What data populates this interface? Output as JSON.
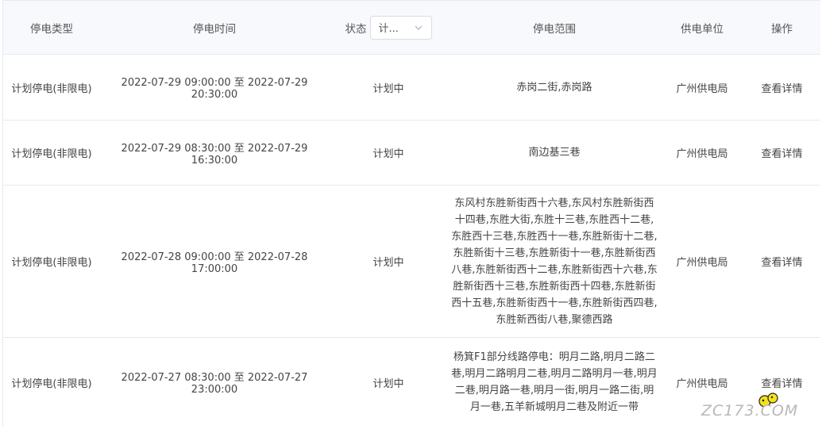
{
  "header": {
    "type": "停电类型",
    "time": "停电时间",
    "status": "状态",
    "status_select": "计...",
    "range": "停电范围",
    "unit": "供电单位",
    "action": "操作"
  },
  "rows": [
    {
      "type": "计划停电(非限电)",
      "time": "2022-07-29 09:00:00 至 2022-07-29 20:30:00",
      "status": "计划中",
      "range": "赤岗二街,赤岗路",
      "unit": "广州供电局",
      "action": "查看详情"
    },
    {
      "type": "计划停电(非限电)",
      "time": "2022-07-29 08:30:00 至 2022-07-29 16:30:00",
      "status": "计划中",
      "range": "南边基三巷",
      "unit": "广州供电局",
      "action": "查看详情"
    },
    {
      "type": "计划停电(非限电)",
      "time": "2022-07-28 09:00:00 至 2022-07-28 17:00:00",
      "status": "计划中",
      "range": "东风村东胜新街西十六巷,东风村东胜新街西十四巷,东胜大街,东胜十三巷,东胜西十二巷,东胜西十三巷,东胜西十一巷,东胜新街十二巷,东胜新街十三巷,东胜新街十一巷,东胜新街西八巷,东胜新街西十二巷,东胜新街西十六巷,东胜新街西十三巷,东胜新街西十四巷,东胜新街西十五巷,东胜新街西十一巷,东胜新街西四巷,东胜新西街八巷,聚德西路",
      "unit": "广州供电局",
      "action": "查看详情"
    },
    {
      "type": "计划停电(非限电)",
      "time": "2022-07-27 08:30:00 至 2022-07-27 23:00:00",
      "status": "计划中",
      "range": "杨箕F1部分线路停电：明月二路,明月二路二巷,明月二路明月二巷,明月二路明月一巷,明月二巷,明月路一巷,明月一街,明月一路二街,明月一巷,五羊新城明月二巷及附近一带",
      "unit": "广州供电局",
      "action": "查看详情"
    }
  ],
  "watermark": {
    "text": "ZC173.COM",
    "icon": "smiley-face-icon"
  }
}
